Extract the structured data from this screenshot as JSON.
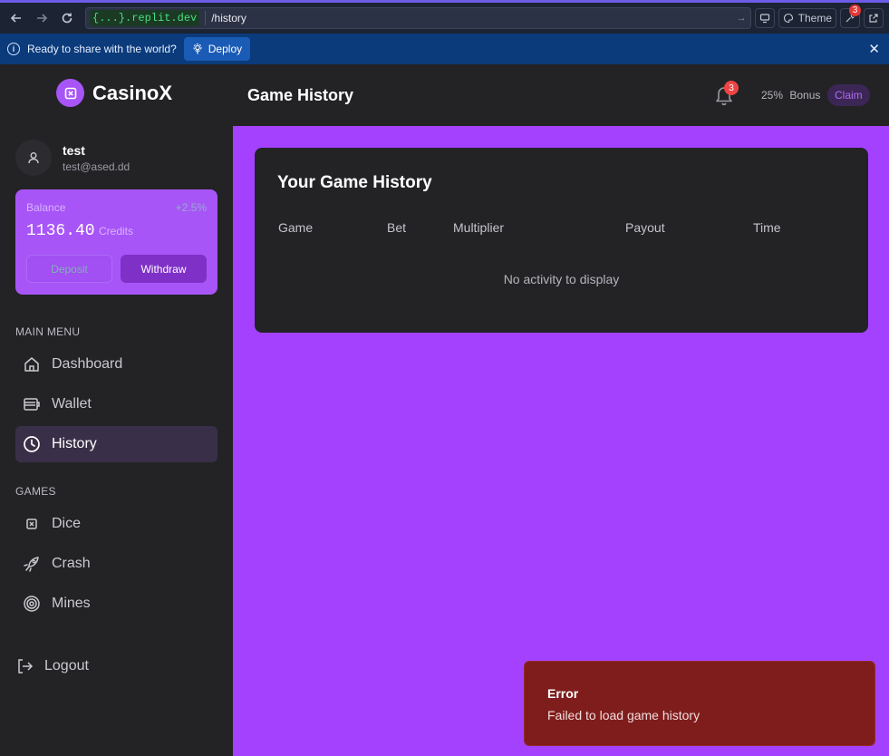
{
  "browser": {
    "url_host": "{...}.replit.dev",
    "url_path": "/history",
    "theme_label": "Theme",
    "tools_badge": "3"
  },
  "share_bar": {
    "message": "Ready to share with the world?",
    "deploy_label": "Deploy"
  },
  "header": {
    "app_name": "CasinoX",
    "page_title": "Game History",
    "notification_count": "3",
    "bonus_percent": "25%",
    "bonus_label": "Bonus",
    "claim_label": "Claim"
  },
  "sidebar": {
    "user": {
      "name": "test",
      "email": "test@ased.dd"
    },
    "balance": {
      "label": "Balance",
      "change": "+2.5%",
      "amount": "1136.40",
      "unit": "Credits",
      "deposit_label": "Deposit",
      "withdraw_label": "Withdraw"
    },
    "main_menu_label": "MAIN MENU",
    "main_menu": [
      {
        "label": "Dashboard",
        "icon": "home-icon"
      },
      {
        "label": "Wallet",
        "icon": "wallet-icon"
      },
      {
        "label": "History",
        "icon": "clock-icon",
        "active": true
      }
    ],
    "games_label": "GAMES",
    "games": [
      {
        "label": "Dice",
        "icon": "dice-icon"
      },
      {
        "label": "Crash",
        "icon": "rocket-icon"
      },
      {
        "label": "Mines",
        "icon": "target-icon"
      }
    ],
    "logout_label": "Logout"
  },
  "main": {
    "card_title": "Your Game History",
    "columns": [
      "Game",
      "Bet",
      "Multiplier",
      "Payout",
      "Time"
    ],
    "empty_message": "No activity to display"
  },
  "toast": {
    "title": "Error",
    "message": "Failed to load game history"
  },
  "colors": {
    "accent": "#a855f7",
    "page_bg": "#a441fe",
    "panel_bg": "#232326",
    "error_bg": "#7f1d1d"
  }
}
